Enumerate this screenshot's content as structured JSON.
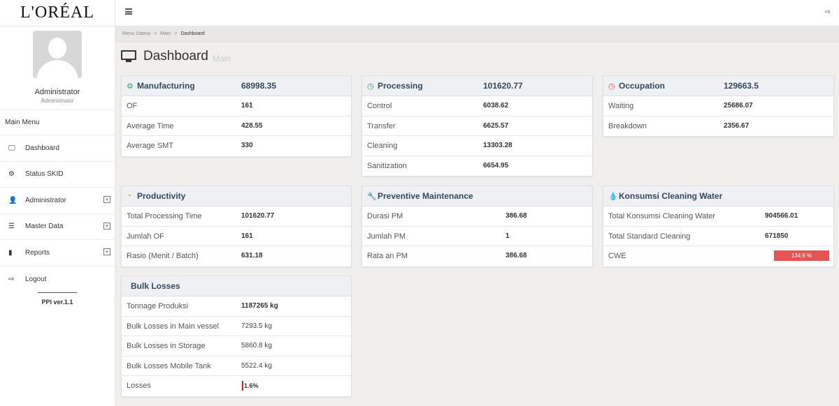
{
  "brand": {
    "logo": "L'ORÉAL"
  },
  "user": {
    "name": "Administrator",
    "role": "Administrator"
  },
  "sidebar": {
    "menu_title": "Main Menu",
    "items": [
      {
        "label": "Dashboard",
        "icon": "monitor-icon",
        "expandable": false
      },
      {
        "label": "Status SKID",
        "icon": "gear-icon",
        "expandable": false
      },
      {
        "label": "Administrator",
        "icon": "user-icon",
        "expandable": true
      },
      {
        "label": "Master Data",
        "icon": "database-icon",
        "expandable": true
      },
      {
        "label": "Reports",
        "icon": "book-icon",
        "expandable": true
      },
      {
        "label": "Logout",
        "icon": "sign-out-icon",
        "expandable": false
      }
    ],
    "version": "PPI ver.1.1"
  },
  "breadcrumb": [
    "Menu Utama",
    "Main",
    "Dashboard"
  ],
  "page": {
    "title": "Dashboard",
    "subtitle": "Main"
  },
  "panels": {
    "manufacturing": {
      "title": "Manufacturing",
      "total": "68998.35",
      "icon": "gear-icon",
      "icon_color": "#27ae60",
      "rows": [
        {
          "label": "OF",
          "value": "161"
        },
        {
          "label": "Average Time",
          "value": "428.55"
        },
        {
          "label": "Average SMT",
          "value": "330"
        }
      ]
    },
    "processing": {
      "title": "Processing",
      "total": "101620.77",
      "icon": "clock-icon",
      "icon_color": "#27ae60",
      "rows": [
        {
          "label": "Control",
          "value": "6038.62"
        },
        {
          "label": "Transfer",
          "value": "6625.57"
        },
        {
          "label": "Cleaning",
          "value": "13303.28"
        },
        {
          "label": "Sanitization",
          "value": "6654.95"
        }
      ]
    },
    "occupation": {
      "title": "Occupation",
      "total": "129663.5",
      "icon": "clock-icon",
      "icon_color": "#e74c3c",
      "rows": [
        {
          "label": "Waiting",
          "value": "25686.07"
        },
        {
          "label": "Breakdown",
          "value": "2356.67"
        }
      ]
    },
    "productivity": {
      "title": "Productivity",
      "icon": "dashboard-icon",
      "icon_color": "#f39c12",
      "rows": [
        {
          "label": "Total Processing Time",
          "value": "101620.77"
        },
        {
          "label": "Jumlah OF",
          "value": "161"
        },
        {
          "label": "Rasio (Menit / Batch)",
          "value": "631.18"
        }
      ]
    },
    "preventive": {
      "title": "Preventive Maintenance",
      "icon": "wrench-icon",
      "icon_color": "#c0392b",
      "rows": [
        {
          "label": "Durasi PM",
          "value": "386.68"
        },
        {
          "label": "Jumlah PM",
          "value": "1"
        },
        {
          "label": "Rata an PM",
          "value": "386.68"
        }
      ]
    },
    "water": {
      "title": "Konsumsi Cleaning Water",
      "icon": "droplet-icon",
      "icon_color": "#2c6fbb",
      "rows": [
        {
          "label": "Total Konsumsi Cleaning Water",
          "value": "904566.01"
        },
        {
          "label": "Total Standard Cleaning",
          "value": "671850"
        },
        {
          "label": "CWE",
          "value": "134.6 %"
        }
      ],
      "cwe_color": "#e35555"
    },
    "bulk": {
      "title": "Bulk Losses",
      "rows": [
        {
          "label": "Tonnage Produksi",
          "value": "1187265 kg"
        },
        {
          "label": "Bulk Losses in Main vessel",
          "value": "7293.5 kg"
        },
        {
          "label": "Bulk Losses in Storage",
          "value": "5860.8 kg"
        },
        {
          "label": "Bulk Losses Mobile Tank",
          "value": "5522.4 kg"
        },
        {
          "label": "Losses",
          "value": "1.6%"
        }
      ],
      "losses_color": "#b22222"
    }
  }
}
